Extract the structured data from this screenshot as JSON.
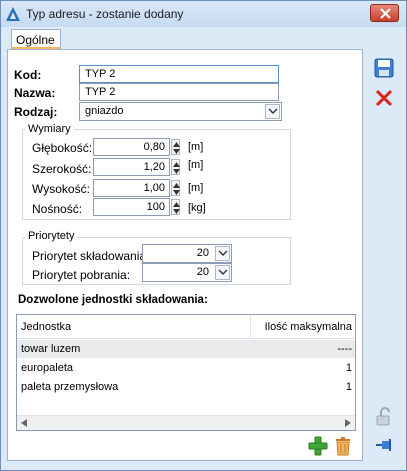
{
  "window": {
    "title": "Typ adresu - zostanie dodany"
  },
  "tabs": [
    {
      "label": "Ogólne"
    }
  ],
  "form": {
    "kod_label": "Kod:",
    "kod_value": "TYP 2",
    "nazwa_label": "Nazwa:",
    "nazwa_value": "TYP 2",
    "rodzaj_label": "Rodzaj:",
    "rodzaj_value": "gniazdo"
  },
  "wymiary": {
    "title": "Wymiary",
    "rows": [
      {
        "label": "Głębokość:",
        "value": "0,80",
        "unit": "[m]"
      },
      {
        "label": "Szerokość:",
        "value": "1,20",
        "unit": "[m]"
      },
      {
        "label": "Wysokość:",
        "value": "1,00",
        "unit": "[m]"
      },
      {
        "label": "Nośność:",
        "value": "100",
        "unit": "[kg]"
      }
    ]
  },
  "priorytety": {
    "title": "Priorytety",
    "rows": [
      {
        "label": "Priorytet składowania:",
        "value": "20"
      },
      {
        "label": "Priorytet pobrania:",
        "value": "20"
      }
    ]
  },
  "units_section": {
    "title": "Dozwolone jednostki składowania:",
    "columns": [
      "Jednostka",
      "Ilość maksymalna"
    ],
    "rows": [
      {
        "name": "towar luzem",
        "qty": "----"
      },
      {
        "name": "europaleta",
        "qty": "1"
      },
      {
        "name": "paleta przemysłowa",
        "qty": "1"
      }
    ]
  },
  "icons": {
    "app": "app-triangle-icon",
    "close": "close-icon",
    "save": "save-icon",
    "cancel": "cancel-icon",
    "add": "add-icon",
    "delete": "delete-icon",
    "lock": "lock-icon",
    "pin": "pin-icon"
  },
  "colors": {
    "accent": "#5b8fcf",
    "close": "#c7402a",
    "add": "#3fa535",
    "delete": "#d98b2b"
  }
}
